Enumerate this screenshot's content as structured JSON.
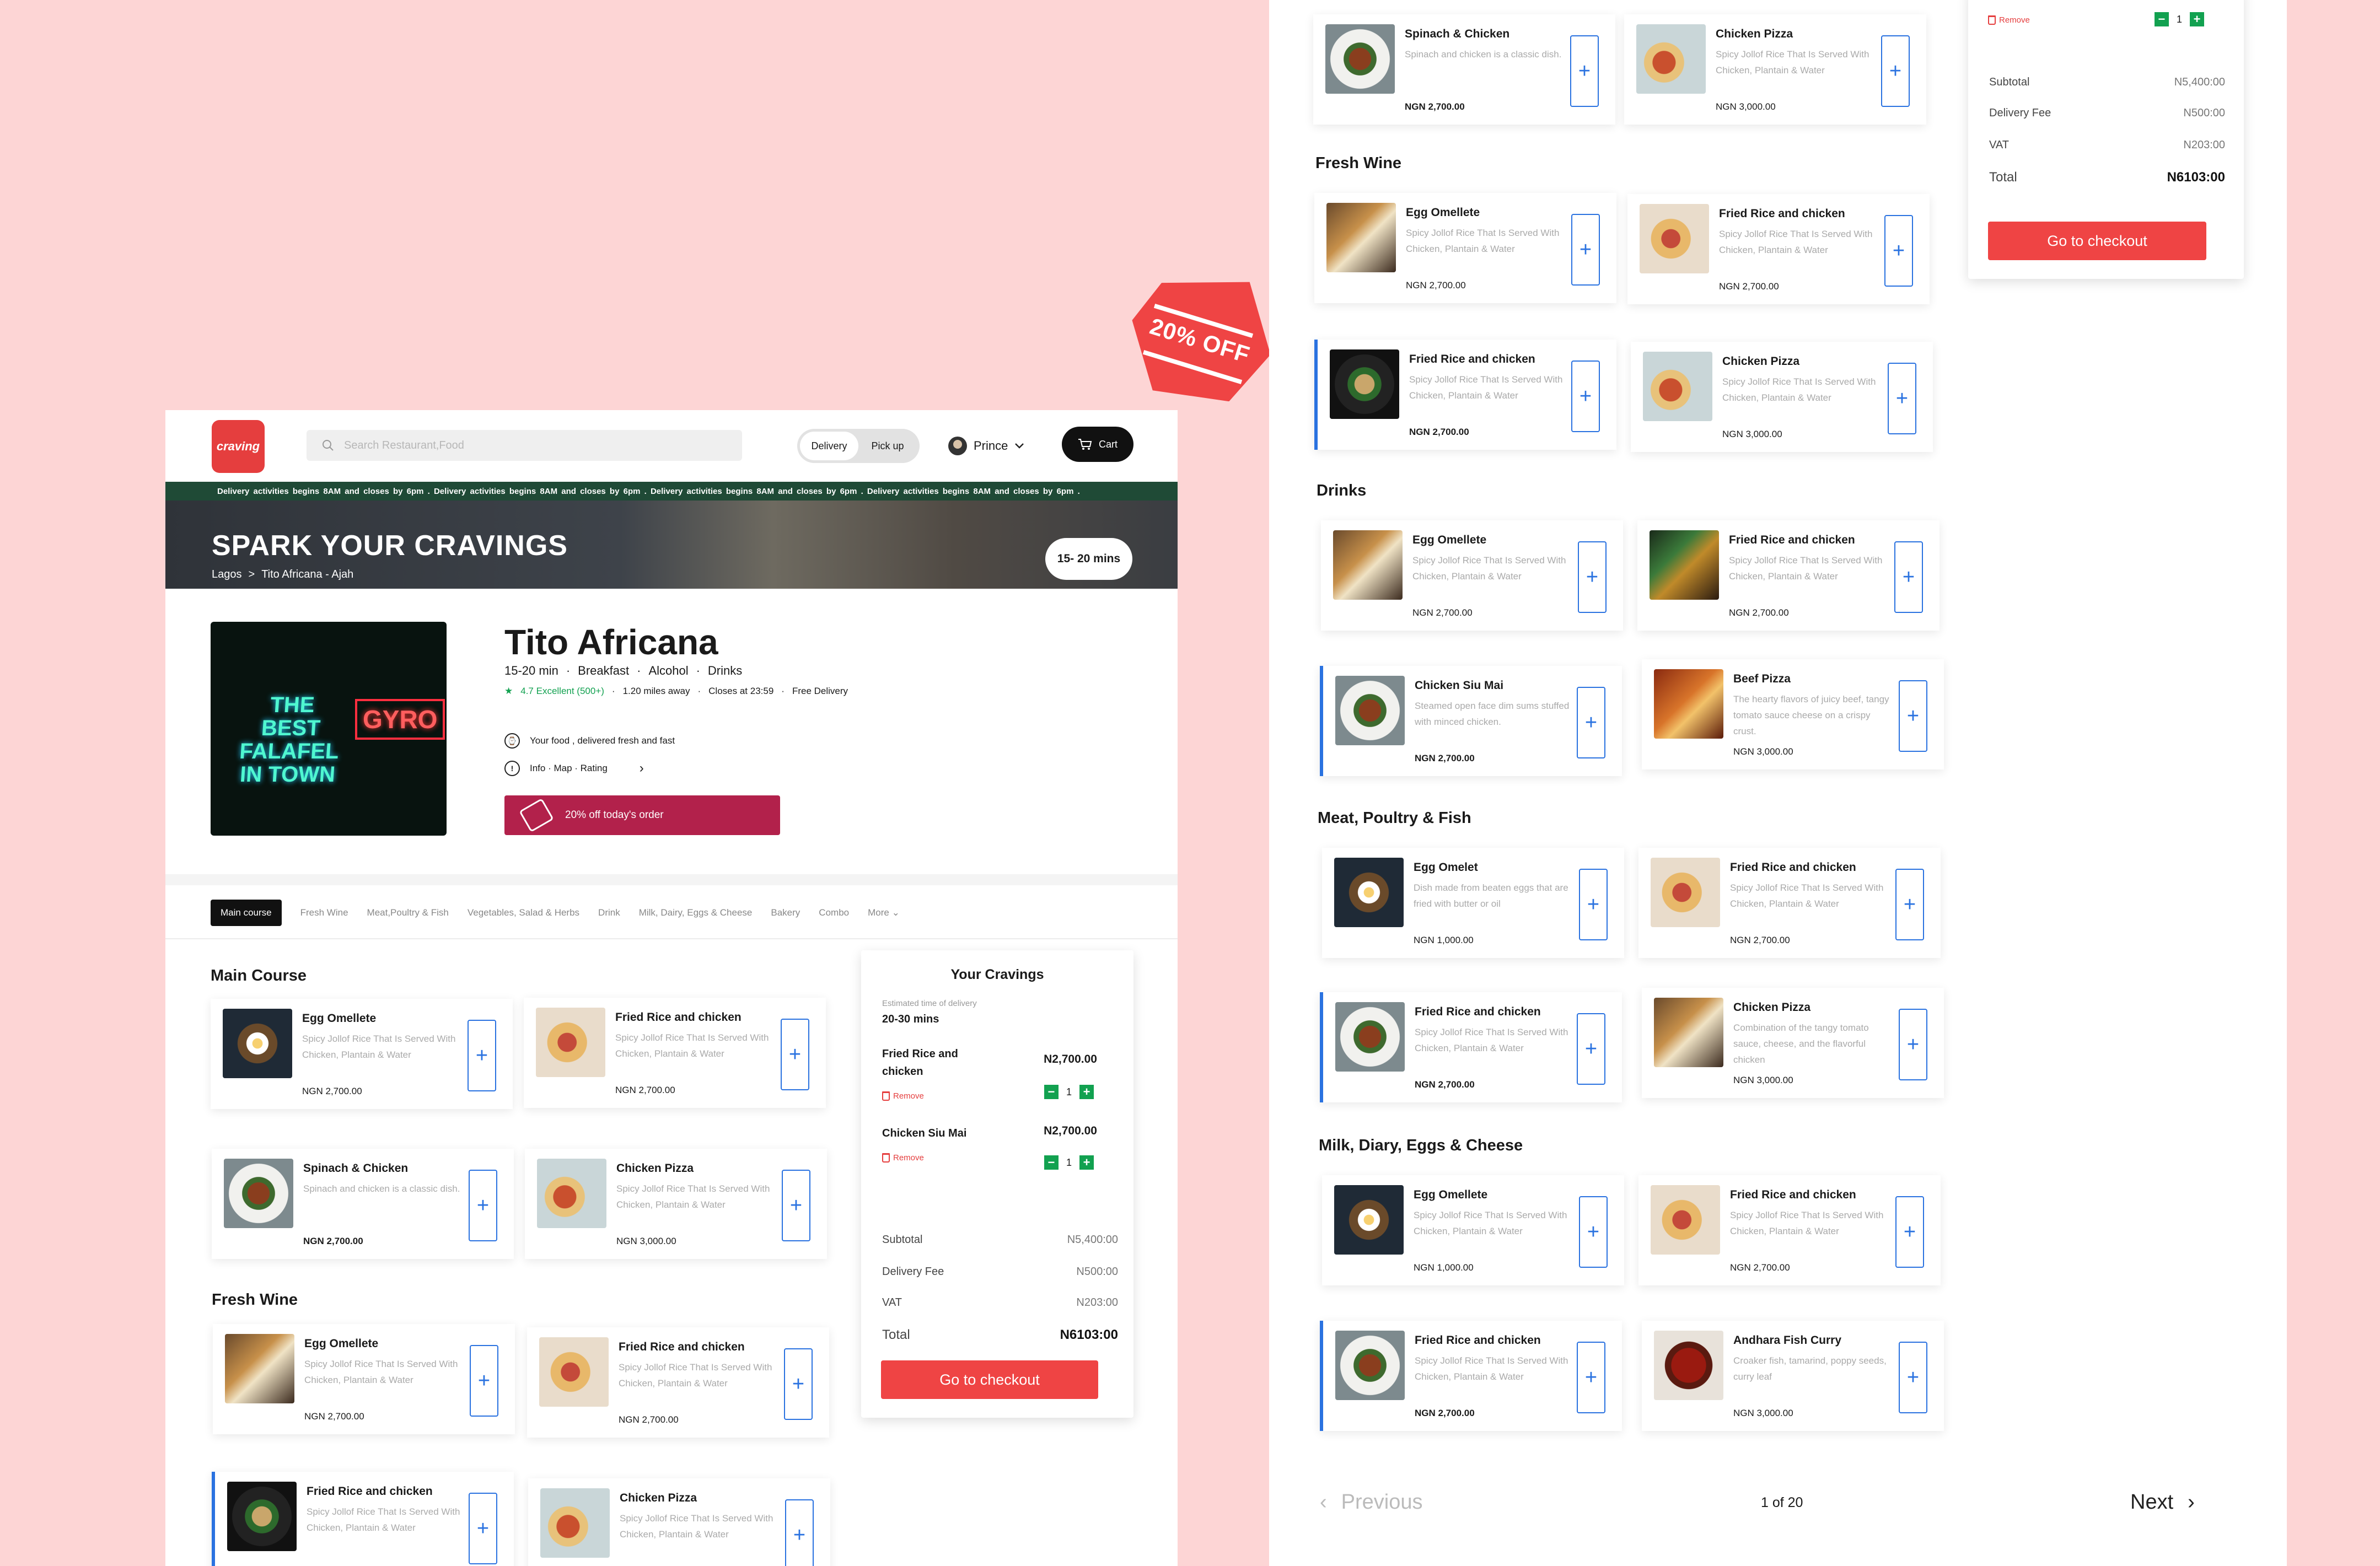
{
  "header": {
    "logo_text": "craving",
    "search_placeholder": "Search Restaurant,Food",
    "mode_toggle": {
      "delivery": "Delivery",
      "pickup": "Pick up",
      "active": "Delivery"
    },
    "user_name": "Prince",
    "cart_label": "Cart"
  },
  "ticker_text": "Delivery activities begins 8AM  and closes by 6pm .   Delivery activities begins 8AM  and closes by 6pm .   Delivery activities begins 8AM  and closes by 6pm .   Delivery activities begins 8AM  and closes by 6pm .",
  "hero": {
    "title": "SPARK YOUR CRAVINGS",
    "breadcrumb": [
      "Lagos",
      "Tito Africana - Ajah"
    ],
    "delivery_time": "15- 20 mins"
  },
  "restaurant": {
    "name": "Tito Africana",
    "meta": [
      "15-20 min",
      "Breakfast",
      "Alcohol",
      "Drinks"
    ],
    "rating": "4.7 Excellent (500+)",
    "distance": "1.20 miles away",
    "closes": "Closes at 23:59",
    "delivery": "Free Delivery",
    "tagline": "Your food , delivered fresh and fast",
    "info_link": "Info · Map · Rating",
    "promo": "20% off today's order",
    "image_sign_1": "THE BEST FALAFEL IN TOWN",
    "image_sign_2": "GYRO"
  },
  "category_tabs": [
    "Main course",
    "Fresh Wine",
    "Meat,Poultry & Fish",
    "Vegetables, Salad & Herbs",
    "Drink",
    "Milk, Dairy, Eggs & Cheese",
    "Bakery",
    "Combo",
    "More"
  ],
  "discount_badge": "20% OFF",
  "left_menu": {
    "main_course_title": "Main Course",
    "fresh_wine_title": "Fresh Wine",
    "items": [
      {
        "name": "Egg Omellete",
        "desc": "Spicy Jollof Rice That Is Served With Chicken, Plantain & Water",
        "price": "NGN 2,700.00"
      },
      {
        "name": "Fried Rice and chicken",
        "desc": "Spicy Jollof Rice That Is Served With Chicken, Plantain & Water",
        "price": "NGN 2,700.00"
      },
      {
        "name": "Spinach & Chicken",
        "desc": "Spinach and chicken is a classic dish.",
        "price": "NGN 2,700.00"
      },
      {
        "name": "Chicken Pizza",
        "desc": "Spicy Jollof Rice That Is Served With Chicken, Plantain & Water",
        "price": "NGN 3,000.00"
      },
      {
        "name": "Egg Omellete",
        "desc": "Spicy Jollof Rice That Is Served With Chicken, Plantain & Water",
        "price": "NGN 2,700.00"
      },
      {
        "name": "Fried Rice and chicken",
        "desc": "Spicy Jollof Rice That Is Served With Chicken, Plantain & Water",
        "price": "NGN 2,700.00"
      },
      {
        "name": "Fried Rice and chicken",
        "desc": "Spicy Jollof Rice That Is Served With Chicken, Plantain & Water",
        "price": ""
      },
      {
        "name": "Chicken Pizza",
        "desc": "Spicy Jollof Rice That Is Served With Chicken, Plantain & Water",
        "price": ""
      }
    ]
  },
  "order": {
    "title": "Your Cravings",
    "eta_label": "Estimated time of delivery",
    "eta": "20-30 mins",
    "items": [
      {
        "name": "Fried Rice and chicken",
        "price": "N2,700.00",
        "qty": "1",
        "remove": "Remove"
      },
      {
        "name": "Chicken Siu Mai",
        "price": "N2,700.00",
        "qty": "1",
        "remove": "Remove"
      }
    ],
    "subtotal_label": "Subtotal",
    "subtotal": "N5,400:00",
    "delivery_label": "Delivery Fee",
    "delivery": "N500:00",
    "vat_label": "VAT",
    "vat": "N203:00",
    "total_label": "Total",
    "total": "N6103:00",
    "checkout": "Go to checkout"
  },
  "right_menu": {
    "sections": [
      "Fresh Wine",
      "Drinks",
      "Meat, Poultry & Fish",
      "Milk, Diary, Eggs & Cheese"
    ],
    "items": [
      {
        "name": "Spinach & Chicken",
        "desc": "Spinach and chicken is a classic dish.",
        "price": "NGN 2,700.00"
      },
      {
        "name": "Chicken Pizza",
        "desc": "Spicy Jollof Rice That Is Served With Chicken, Plantain & Water",
        "price": "NGN 3,000.00"
      },
      {
        "name": "Egg Omellete",
        "desc": "Spicy Jollof Rice That Is Served With Chicken, Plantain & Water",
        "price": "NGN 2,700.00"
      },
      {
        "name": "Fried Rice and chicken",
        "desc": "Spicy Jollof Rice That Is Served With Chicken, Plantain & Water",
        "price": "NGN 2,700.00"
      },
      {
        "name": "Fried Rice and chicken",
        "desc": "Spicy Jollof Rice That Is Served With Chicken, Plantain & Water",
        "price": "NGN 2,700.00"
      },
      {
        "name": "Chicken Pizza",
        "desc": "Spicy Jollof Rice That Is Served With Chicken, Plantain & Water",
        "price": "NGN 3,000.00"
      },
      {
        "name": "Egg Omellete",
        "desc": "Spicy Jollof Rice That Is Served With Chicken, Plantain & Water",
        "price": "NGN 2,700.00"
      },
      {
        "name": "Fried Rice and chicken",
        "desc": "Spicy Jollof Rice That Is Served With Chicken, Plantain & Water",
        "price": "NGN 2,700.00"
      },
      {
        "name": "Chicken Siu Mai",
        "desc": "Steamed open face dim sums stuffed with minced chicken.",
        "price": "NGN 2,700.00"
      },
      {
        "name": "Beef Pizza",
        "desc": "The hearty flavors of juicy beef, tangy tomato sauce cheese on a crispy crust.",
        "price": "NGN 3,000.00"
      },
      {
        "name": "Egg Omelet",
        "desc": "Dish made from beaten eggs that are fried with butter or oil",
        "price": "NGN 1,000.00"
      },
      {
        "name": "Fried Rice and chicken",
        "desc": "Spicy Jollof Rice That Is Served With Chicken, Plantain & Water",
        "price": "NGN 2,700.00"
      },
      {
        "name": "Fried Rice and chicken",
        "desc": "Spicy Jollof Rice That Is Served With Chicken, Plantain & Water",
        "price": "NGN 2,700.00"
      },
      {
        "name": "Chicken Pizza",
        "desc": "Combination of the tangy tomato sauce, cheese, and the flavorful chicken",
        "price": "NGN 3,000.00"
      },
      {
        "name": "Egg Omellete",
        "desc": "Spicy Jollof Rice That Is Served With Chicken, Plantain & Water",
        "price": "NGN 1,000.00"
      },
      {
        "name": "Fried Rice and chicken",
        "desc": "Spicy Jollof Rice That Is Served With Chicken, Plantain & Water",
        "price": "NGN 2,700.00"
      },
      {
        "name": "Fried Rice and chicken",
        "desc": "Spicy Jollof Rice That Is Served With Chicken, Plantain & Water",
        "price": "NGN 2,700.00"
      },
      {
        "name": "Andhara Fish Curry",
        "desc": "Croaker fish, tamarind, poppy seeds, curry leaf",
        "price": "NGN 3,000.00"
      }
    ]
  },
  "pagination": {
    "previous": "Previous",
    "page": "1 of 20",
    "next": "Next"
  },
  "colors": {
    "accent_red": "#ef4444",
    "promo": "#b2214b",
    "ticker": "#1f4a36",
    "add_blue": "#2a72e0",
    "green": "#12a150",
    "background": "#fdd5d5"
  }
}
